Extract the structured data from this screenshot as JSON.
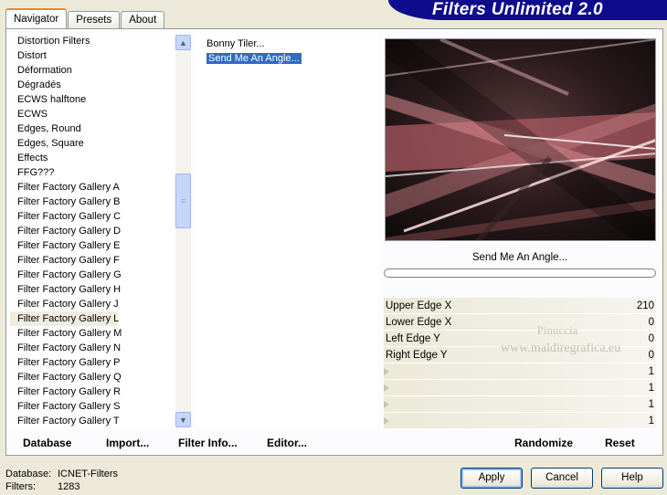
{
  "tabs": [
    "Navigator",
    "Presets",
    "About"
  ],
  "banner_title": "Filters Unlimited 2.0",
  "categories": [
    "Distortion Filters",
    "Distort",
    "Déformation",
    "Dégradés",
    "ECWS halftone",
    "ECWS",
    "Edges, Round",
    "Edges, Square",
    "Effects",
    "FFG???",
    "Filter Factory Gallery A",
    "Filter Factory Gallery B",
    "Filter Factory Gallery C",
    "Filter Factory Gallery D",
    "Filter Factory Gallery E",
    "Filter Factory Gallery F",
    "Filter Factory Gallery G",
    "Filter Factory Gallery H",
    "Filter Factory Gallery J",
    "Filter Factory Gallery L",
    "Filter Factory Gallery M",
    "Filter Factory Gallery N",
    "Filter Factory Gallery P",
    "Filter Factory Gallery Q",
    "Filter Factory Gallery R",
    "Filter Factory Gallery S",
    "Filter Factory Gallery T"
  ],
  "selected_category": "Filter Factory Gallery L",
  "filters": [
    "Bonny Tiler...",
    "Send Me An Angle..."
  ],
  "selected_filter": "Send Me An Angle...",
  "preview_filter_name": "Send Me An Angle...",
  "watermark": {
    "line1": "Pinuccia",
    "line2": "www.maldiregrafica.eu"
  },
  "params": [
    {
      "label": "Upper Edge X",
      "value": "210"
    },
    {
      "label": "Lower Edge X",
      "value": "0"
    },
    {
      "label": "Left Edge Y",
      "value": "0"
    },
    {
      "label": "Right Edge Y",
      "value": "0"
    },
    {
      "label": "",
      "value": "1"
    },
    {
      "label": "",
      "value": "1"
    },
    {
      "label": "",
      "value": "1"
    },
    {
      "label": "",
      "value": "1"
    }
  ],
  "left_buttons": {
    "database": "Database",
    "import": "Import...",
    "filter_info": "Filter Info...",
    "editor": "Editor..."
  },
  "right_buttons": {
    "randomize": "Randomize",
    "reset": "Reset"
  },
  "status": {
    "database_label": "Database:",
    "database_value": "ICNET-Filters",
    "filters_label": "Filters:",
    "filters_value": "1283"
  },
  "dialog_buttons": {
    "apply": "Apply",
    "cancel": "Cancel",
    "help": "Help"
  },
  "colors": {
    "banner": "#0e0b8c",
    "selection": "#316ac5",
    "tab_accent": "#e68b2c"
  }
}
